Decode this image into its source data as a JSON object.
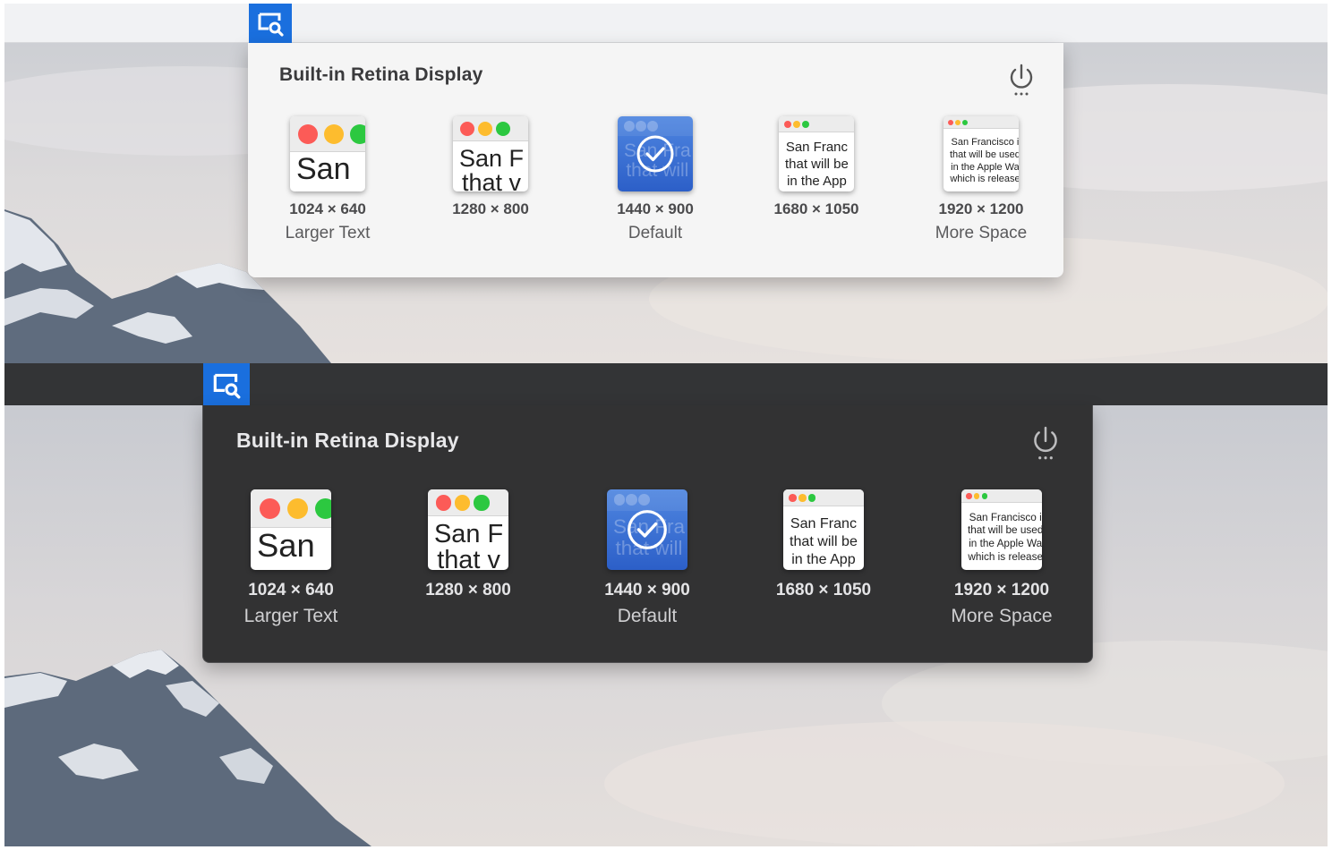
{
  "panel": {
    "title": "Built-in Retina Display"
  },
  "resolutions": [
    {
      "size": "1024 × 640",
      "label": "Larger Text",
      "preview": [
        "San"
      ],
      "selected": false
    },
    {
      "size": "1280 × 800",
      "label": "",
      "preview": [
        "San F",
        "that v"
      ],
      "selected": false
    },
    {
      "size": "1440 × 900",
      "label": "Default",
      "preview": [
        "San Fra",
        "that will"
      ],
      "selected": true
    },
    {
      "size": "1680 × 1050",
      "label": "",
      "preview": [
        "San Franc",
        "that will be",
        "in the App"
      ],
      "selected": false
    },
    {
      "size": "1920 × 1200",
      "label": "More Space",
      "preview": [
        "San Francisco i",
        "that will be used",
        "in the Apple Wa",
        "which is release"
      ],
      "selected": false
    }
  ],
  "icons": {
    "tray": "display-search-icon",
    "power": "power-icon",
    "selected": "checkmark-icon"
  },
  "colors": {
    "accent": "#1a6fde",
    "light_panel": "#f5f5f5",
    "dark_panel": "#323233",
    "traffic_red": "#fc5b57",
    "traffic_yellow": "#fdbc2e",
    "traffic_green": "#2cc840"
  }
}
